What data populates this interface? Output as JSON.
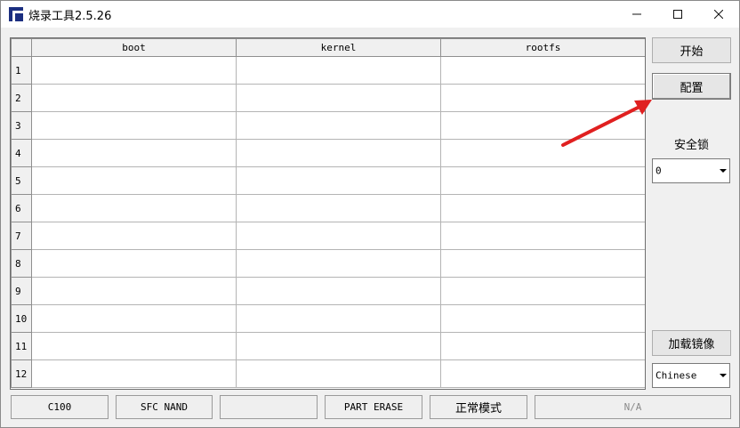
{
  "window": {
    "title": "烧录工具2.5.26",
    "icon": "app-logo-icon",
    "controls": [
      "minimize-icon",
      "maximize-icon",
      "close-icon"
    ]
  },
  "grid": {
    "columns": [
      "boot",
      "kernel",
      "rootfs"
    ],
    "row_numbers": [
      "1",
      "2",
      "3",
      "4",
      "5",
      "6",
      "7",
      "8",
      "9",
      "10",
      "11",
      "12"
    ]
  },
  "side": {
    "start_label": "开始",
    "config_label": "配置",
    "lock_label": "安全锁",
    "lock_value": "0",
    "load_image_label": "加载镜像",
    "language_value": "Chinese"
  },
  "status_bar": {
    "chip": "C100",
    "flash_type": "SFC NAND",
    "empty": "",
    "erase_mode": "PART ERASE",
    "mode": "正常模式",
    "info": "N/A"
  },
  "annotation": {
    "arrow_color": "#e02020"
  }
}
